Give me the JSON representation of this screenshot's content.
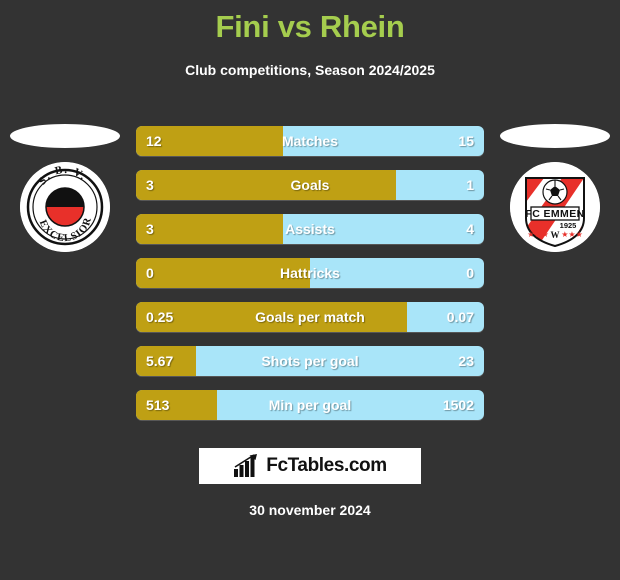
{
  "header": {
    "title": "Fini vs Rhein",
    "subtitle": "Club competitions, Season 2024/2025",
    "title_color": "#a5cd4e"
  },
  "teams": {
    "home": {
      "name": "S.B.V. Excelsior",
      "badge_lines": [
        "S. B. V.",
        "EXCELSIOR"
      ],
      "colors": {
        "primary": "#000000",
        "secondary": "#e8302a",
        "badge_bg": "#ffffff"
      }
    },
    "away": {
      "name": "FC Emmen",
      "badge_lines": [
        "FC EMMEN",
        "1925"
      ],
      "colors": {
        "primary": "#e8302a",
        "secondary": "#ffffff",
        "badge_bg": "#ffffff"
      }
    }
  },
  "colors": {
    "background": "#333333",
    "home_bar": "#bfa014",
    "away_bar": "#a9e5f9",
    "value_text": "#ffffff"
  },
  "chart_data": {
    "type": "bar",
    "title": "Fini vs Rhein",
    "subtitle": "Club competitions, Season 2024/2025",
    "orientation": "horizontal-diverging",
    "legend": [
      "S.B.V. Excelsior",
      "FC Emmen"
    ],
    "categories": [
      "Matches",
      "Goals",
      "Assists",
      "Hattricks",
      "Goals per match",
      "Shots per goal",
      "Min per goal"
    ],
    "series": [
      {
        "name": "S.B.V. Excelsior",
        "color": "#bfa014",
        "values": [
          12,
          3,
          3,
          0,
          0.25,
          5.67,
          513
        ],
        "labels": [
          "12",
          "3",
          "3",
          "0",
          "0.25",
          "5.67",
          "513"
        ]
      },
      {
        "name": "FC Emmen",
        "color": "#a9e5f9",
        "values": [
          15,
          1,
          4,
          0,
          0.07,
          23,
          1502
        ],
        "labels": [
          "15",
          "1",
          "4",
          "0",
          "0.07",
          "23",
          "1502"
        ]
      }
    ],
    "home_fill_percent": [
      42.2,
      74.7,
      42.2,
      50,
      77.8,
      17.3,
      23.2
    ]
  },
  "rows": [
    {
      "label": "Matches",
      "home": "12",
      "away": "15",
      "fill": 42.2
    },
    {
      "label": "Goals",
      "home": "3",
      "away": "1",
      "fill": 74.7
    },
    {
      "label": "Assists",
      "home": "3",
      "away": "4",
      "fill": 42.2
    },
    {
      "label": "Hattricks",
      "home": "0",
      "away": "0",
      "fill": 50.0
    },
    {
      "label": "Goals per match",
      "home": "0.25",
      "away": "0.07",
      "fill": 77.8
    },
    {
      "label": "Shots per goal",
      "home": "5.67",
      "away": "23",
      "fill": 17.3
    },
    {
      "label": "Min per goal",
      "home": "513",
      "away": "1502",
      "fill": 23.2
    }
  ],
  "footer": {
    "brand": "FcTables.com",
    "brand_icon": "bar-chart-icon",
    "date": "30 november 2024"
  }
}
